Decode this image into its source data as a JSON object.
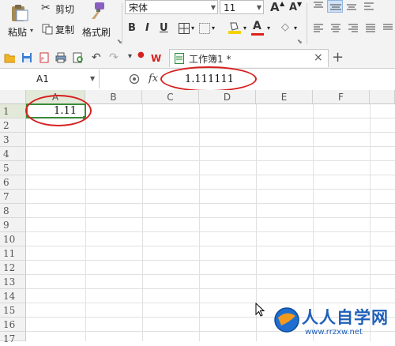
{
  "clipboard": {
    "paste_label": "粘贴",
    "cut_label": "剪切",
    "copy_label": "复制",
    "format_painter_label": "格式刷"
  },
  "font": {
    "name": "宋体",
    "size": "11"
  },
  "format_buttons": {
    "bold": "B",
    "italic": "I",
    "underline": "U"
  },
  "grow_font": "A",
  "shrink_font": "A",
  "font_color_letter": "A",
  "document_tab": {
    "title": "工作簿1 *",
    "close": "×",
    "new_tab": "+"
  },
  "formula_bar": {
    "cell_ref": "A1",
    "fx": "fx",
    "value": "1.111111"
  },
  "sheet": {
    "columns": [
      "A",
      "B",
      "C",
      "D",
      "E",
      "F"
    ],
    "rows": [
      "1",
      "2",
      "3",
      "4",
      "5",
      "6",
      "7",
      "8",
      "9",
      "10",
      "11",
      "12",
      "13",
      "14",
      "15",
      "16",
      "17"
    ],
    "cell_A1": "1.11"
  },
  "watermark": {
    "text": "人人自学网",
    "url": "www.rrzxw.net"
  },
  "colors": {
    "accent_red": "#d62020",
    "selection_green": "#217346",
    "watermark_blue": "#1f5fb8"
  }
}
